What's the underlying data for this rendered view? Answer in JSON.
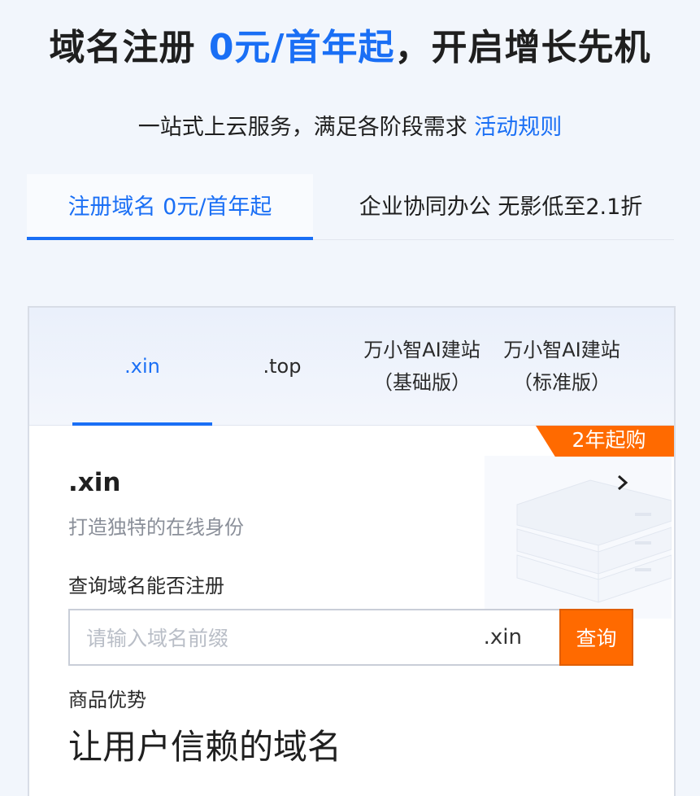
{
  "hero": {
    "title_prefix": "域名注册 ",
    "title_accent": "0元/首年起",
    "title_suffix": "，开启增长先机"
  },
  "subtitle": {
    "text": "一站式上云服务，满足各阶段需求 ",
    "link": "活动规则"
  },
  "top_tabs": [
    {
      "label": "注册域名 0元/首年起",
      "active": true
    },
    {
      "label": "企业协同办公 无影低至2.1折",
      "active": false
    }
  ],
  "card_tabs": [
    {
      "line1": ".xin",
      "line2": "",
      "active": true
    },
    {
      "line1": ".top",
      "line2": "",
      "active": false
    },
    {
      "line1": "万小智AI建站",
      "line2": "（基础版）",
      "active": false
    },
    {
      "line1": "万小智AI建站",
      "line2": "（标准版）",
      "active": false
    }
  ],
  "product": {
    "badge": "2年起购",
    "name": ".xin",
    "description": "打造独特的在线身份",
    "query_label": "查询域名能否注册",
    "search_placeholder": "请输入域名前缀",
    "search_suffix": ".xin",
    "search_button": "查询",
    "advantage_label": "商品优势",
    "advantage_title": "让用户信赖的域名"
  },
  "icons": {
    "chevron": "chevron-right-icon",
    "illustration": "server-illustration"
  },
  "colors": {
    "accent": "#1a6ff5",
    "cta": "#ff6a00",
    "background": "#f2f6fc"
  }
}
